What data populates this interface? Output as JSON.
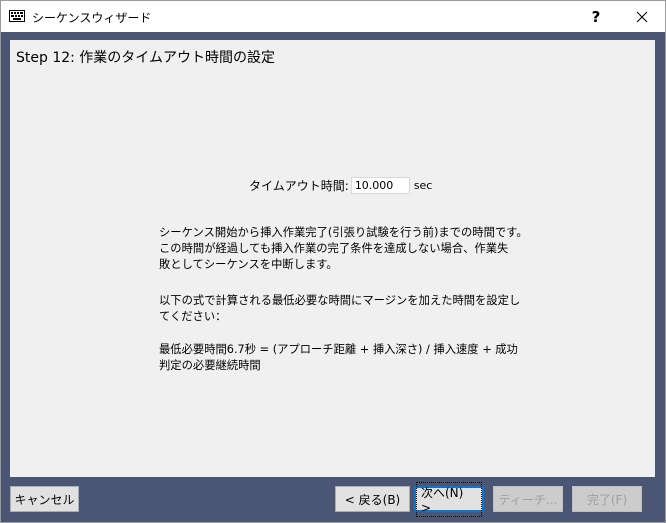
{
  "window": {
    "title": "シーケンスウィザード",
    "help_symbol": "?",
    "close_symbol": "✕",
    "icon": "keyboard-icon"
  },
  "step": {
    "title": "Step 12: 作業のタイムアウト時間の設定"
  },
  "timeout": {
    "label": "タイムアウト時間:",
    "value": "10.000",
    "unit": "sec"
  },
  "description": {
    "paragraph1": [
      "シーケンス開始から挿入作業完了(引張り試験を行う前)までの時間です。",
      "この時間が経過しても挿入作業の完了条件を達成しない場合、作業失",
      "敗としてシーケンスを中断します。"
    ],
    "paragraph2": [
      "以下の式で計算される最低必要な時間にマージンを加えた時間を設定し",
      "てください："
    ],
    "paragraph3": [
      "最低必要時間6.7秒 = (アプローチ距離 + 挿入深さ) / 挿入速度 + 成功",
      "判定の必要継続時間"
    ]
  },
  "buttons": {
    "cancel": "キャンセル",
    "back": "< 戻る(B)",
    "next": "次へ(N) >",
    "teach": "ティーチ...",
    "finish": "完了(F)"
  },
  "colors": {
    "frame": "#4a5673",
    "panel": "#f0f0f0",
    "focus_border": "#0078d7"
  }
}
